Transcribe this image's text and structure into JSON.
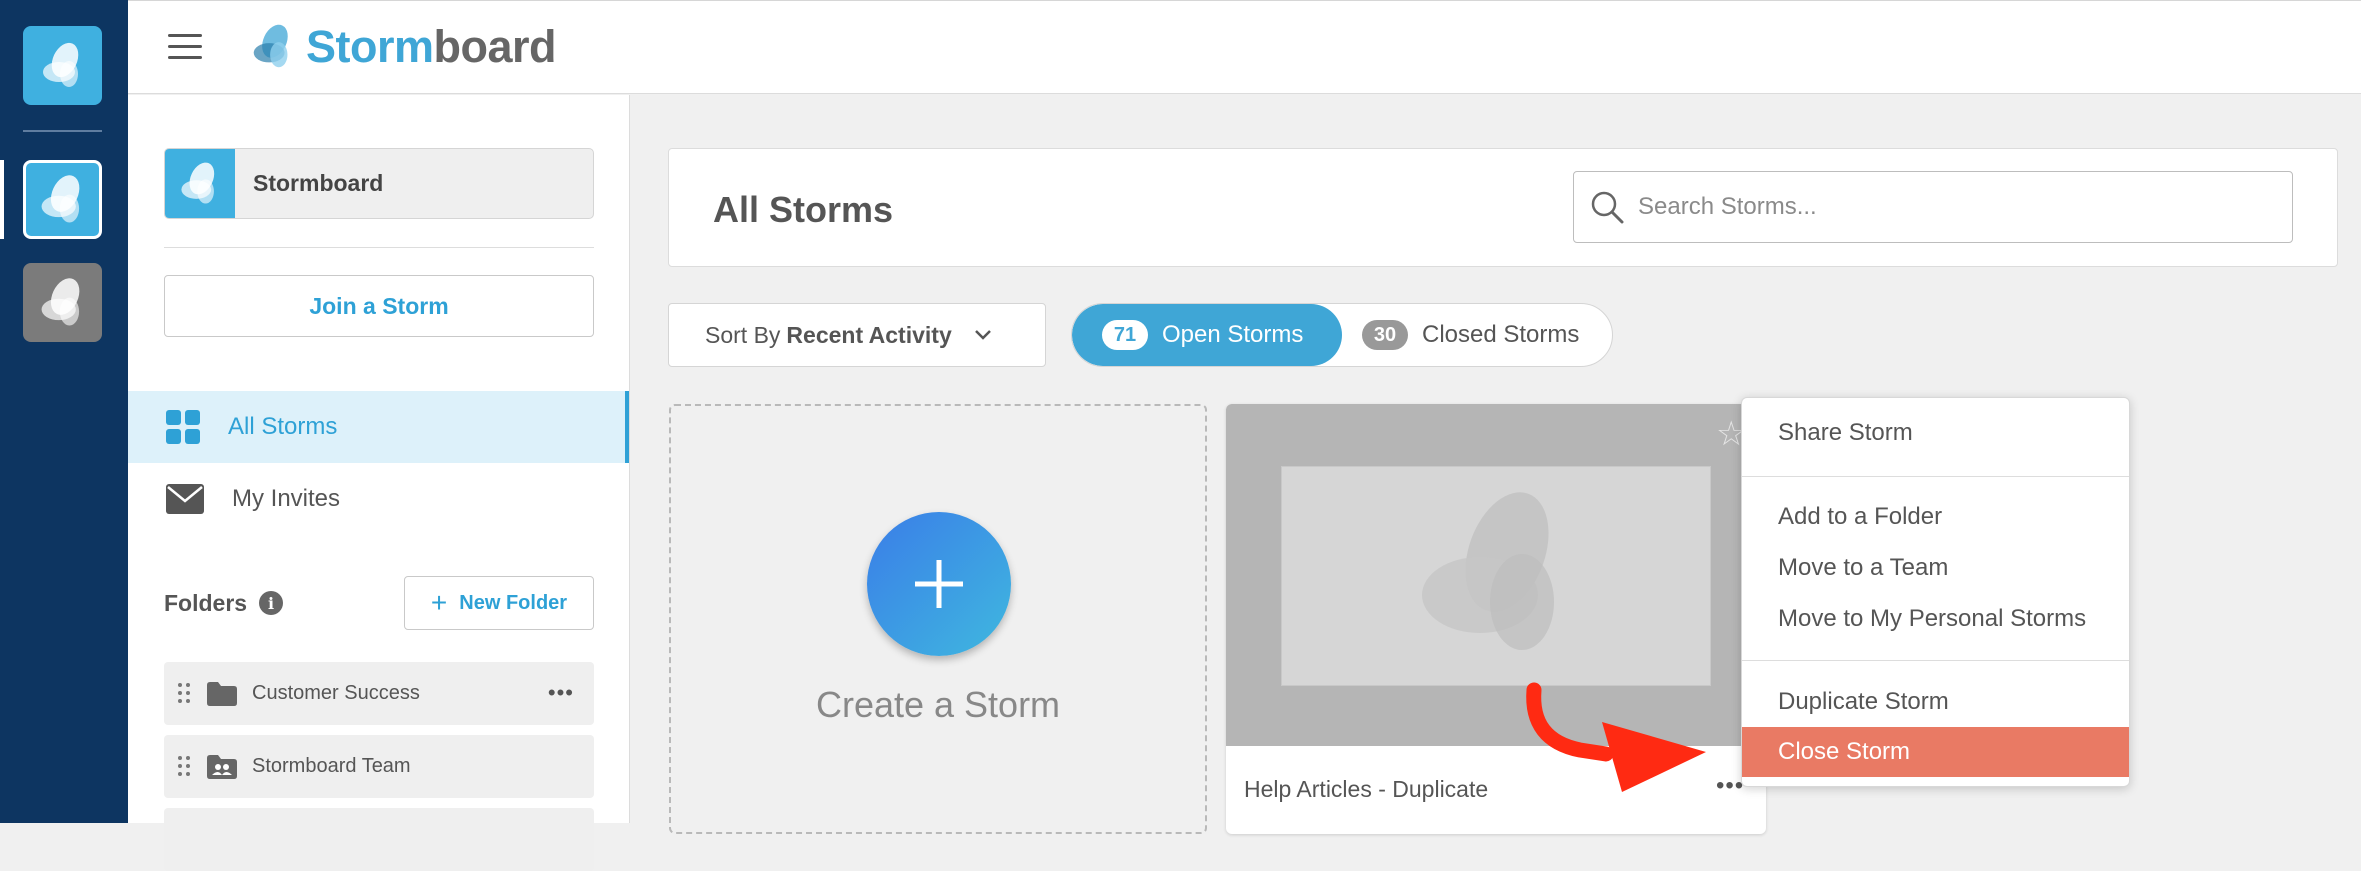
{
  "app": {
    "logo_storm": "Storm",
    "logo_board": "board"
  },
  "sidebar": {
    "org_name": "Stormboard",
    "join_label": "Join a Storm",
    "nav": [
      {
        "label": "All Storms",
        "icon": "grid-icon",
        "active": true
      },
      {
        "label": "My Invites",
        "icon": "mail-icon",
        "active": false
      }
    ],
    "folders_title": "Folders",
    "new_folder_label": "New Folder",
    "folders": [
      {
        "name": "Customer Success",
        "icon": "folder-icon"
      },
      {
        "name": "Stormboard Team",
        "icon": "team-folder-icon"
      }
    ]
  },
  "main": {
    "title": "All Storms",
    "search_placeholder": "Search Storms...",
    "sort_prefix": "Sort By",
    "sort_value": "Recent Activity",
    "tabs": [
      {
        "count": "71",
        "label": "Open Storms",
        "selected": true
      },
      {
        "count": "30",
        "label": "Closed Storms",
        "selected": false
      }
    ],
    "create_label": "Create a Storm",
    "storms": [
      {
        "title": "Help Articles - Duplicate"
      }
    ]
  },
  "context_menu": {
    "items": [
      {
        "label": "Share Storm"
      },
      {
        "label": "Add to a Folder"
      },
      {
        "label": "Move to a Team"
      },
      {
        "label": "Move to My Personal Storms"
      },
      {
        "label": "Duplicate Storm"
      },
      {
        "label": "Close Storm",
        "highlighted": true
      }
    ]
  },
  "colors": {
    "brand_blue": "#3fa6d6",
    "rail_navy": "#0d3561",
    "close_highlight": "#e97a64",
    "annotation_arrow": "#ff2a12"
  }
}
